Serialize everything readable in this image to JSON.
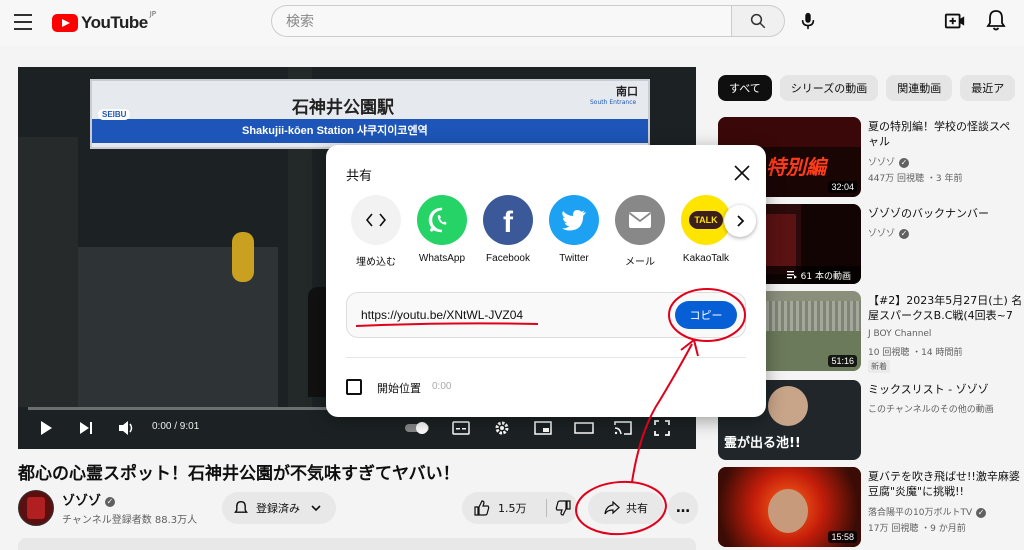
{
  "header": {
    "logo_text": "YouTube",
    "logo_region": "JP",
    "search_placeholder": "検索"
  },
  "player": {
    "sign": {
      "station_jp": "石神井公園駅",
      "station_en": "Shakujii-kōen Station 샤쿠지이코엔역",
      "brand": "SEIBU",
      "exit_jp": "南口",
      "exit_en": "South Entrance"
    },
    "time": "0:00 / 9:01"
  },
  "video": {
    "title": "都心の心霊スポット！石神井公園が不気味すぎてヤバい！",
    "channel_name": "ゾゾゾ",
    "subscribers": "チャンネル登録者数 88.3万人",
    "subscribe_label": "登録済み",
    "like_count": "1.5万",
    "share_label": "共有",
    "more_label": "…"
  },
  "chips": [
    "すべて",
    "シリーズの動画",
    "関連動画",
    "最近ア"
  ],
  "recommendations": [
    {
      "title": "夏の特別編！学校の怪談スペ",
      "title2": "ャル",
      "channel": "ゾゾゾ",
      "meta": "447万 回視聴 ・3 年前",
      "duration": "32:04",
      "thumb_text": "特別編"
    },
    {
      "title": "ゾゾゾのバックナンバー",
      "channel": "ゾゾゾ",
      "playlist_count": "61 本の動画"
    },
    {
      "title": "【#2】2023年5月27日(土) 名",
      "title2": "屋スパークスB.C戦(4回表~7",
      "channel": "J BOY Channel",
      "meta": "10 回視聴 ・14 時間前",
      "badge": "新着",
      "duration": "51:16"
    },
    {
      "title": "ミックスリスト - ゾゾゾ",
      "channel": "このチャンネルのその他の動画",
      "thumb_text": "霊が出る池!!"
    },
    {
      "title": "夏バテを吹き飛ばせ!!激辛麻婆",
      "title2": "豆腐\"炎魔\"に挑戦!!",
      "channel": "落合陽平の10万ボルトTV",
      "meta": "17万 回視聴 ・9 か月前",
      "duration": "15:58"
    }
  ],
  "share_dialog": {
    "title": "共有",
    "targets": [
      {
        "label": "埋め込む",
        "icon": "embed-icon",
        "color": "#f2f2f2"
      },
      {
        "label": "WhatsApp",
        "icon": "whatsapp-icon",
        "color": "#25d366"
      },
      {
        "label": "Facebook",
        "icon": "facebook-icon",
        "color": "#3b5998"
      },
      {
        "label": "Twitter",
        "icon": "twitter-icon",
        "color": "#1da1f2"
      },
      {
        "label": "メール",
        "icon": "mail-icon",
        "color": "#888888"
      },
      {
        "label": "KakaoTalk",
        "icon": "kakaotalk-icon",
        "color": "#fee500"
      }
    ],
    "url": "https://youtu.be/XNtWL-JVZ04",
    "copy_label": "コピー",
    "start_at_label": "開始位置",
    "start_at_time": "0:00",
    "kakao_badge": "TALK"
  },
  "colors": {
    "accent_blue": "#065fd4",
    "annotation_red": "#e0001b",
    "youtube_red": "#ff0000"
  }
}
